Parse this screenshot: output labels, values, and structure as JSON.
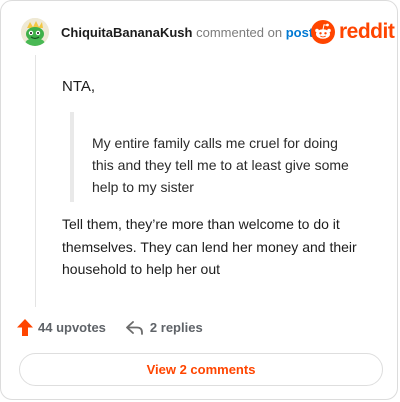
{
  "header": {
    "username": "ChiquitaBananaKush",
    "action_text": "commented on",
    "post_link": "post",
    "logo_text": "reddit"
  },
  "comment": {
    "opening": "NTA,",
    "quote": "My entire family calls me cruel for doing this and they tell me to at least give some help to my sister",
    "body": "Tell them, they’re more than welcome to do it themselves. They can lend her money and their household to help her out"
  },
  "footer": {
    "upvotes": "44 upvotes",
    "replies": "2 replies"
  },
  "view_button": "View 2 comments",
  "icons": {
    "avatar": "user-avatar-icon",
    "logo": "reddit-logo-icon",
    "upvote": "upvote-arrow-icon",
    "reply": "reply-arrow-icon"
  },
  "colors": {
    "brand": "#ff4500",
    "link": "#0079d3",
    "muted": "#7c7c7c"
  }
}
